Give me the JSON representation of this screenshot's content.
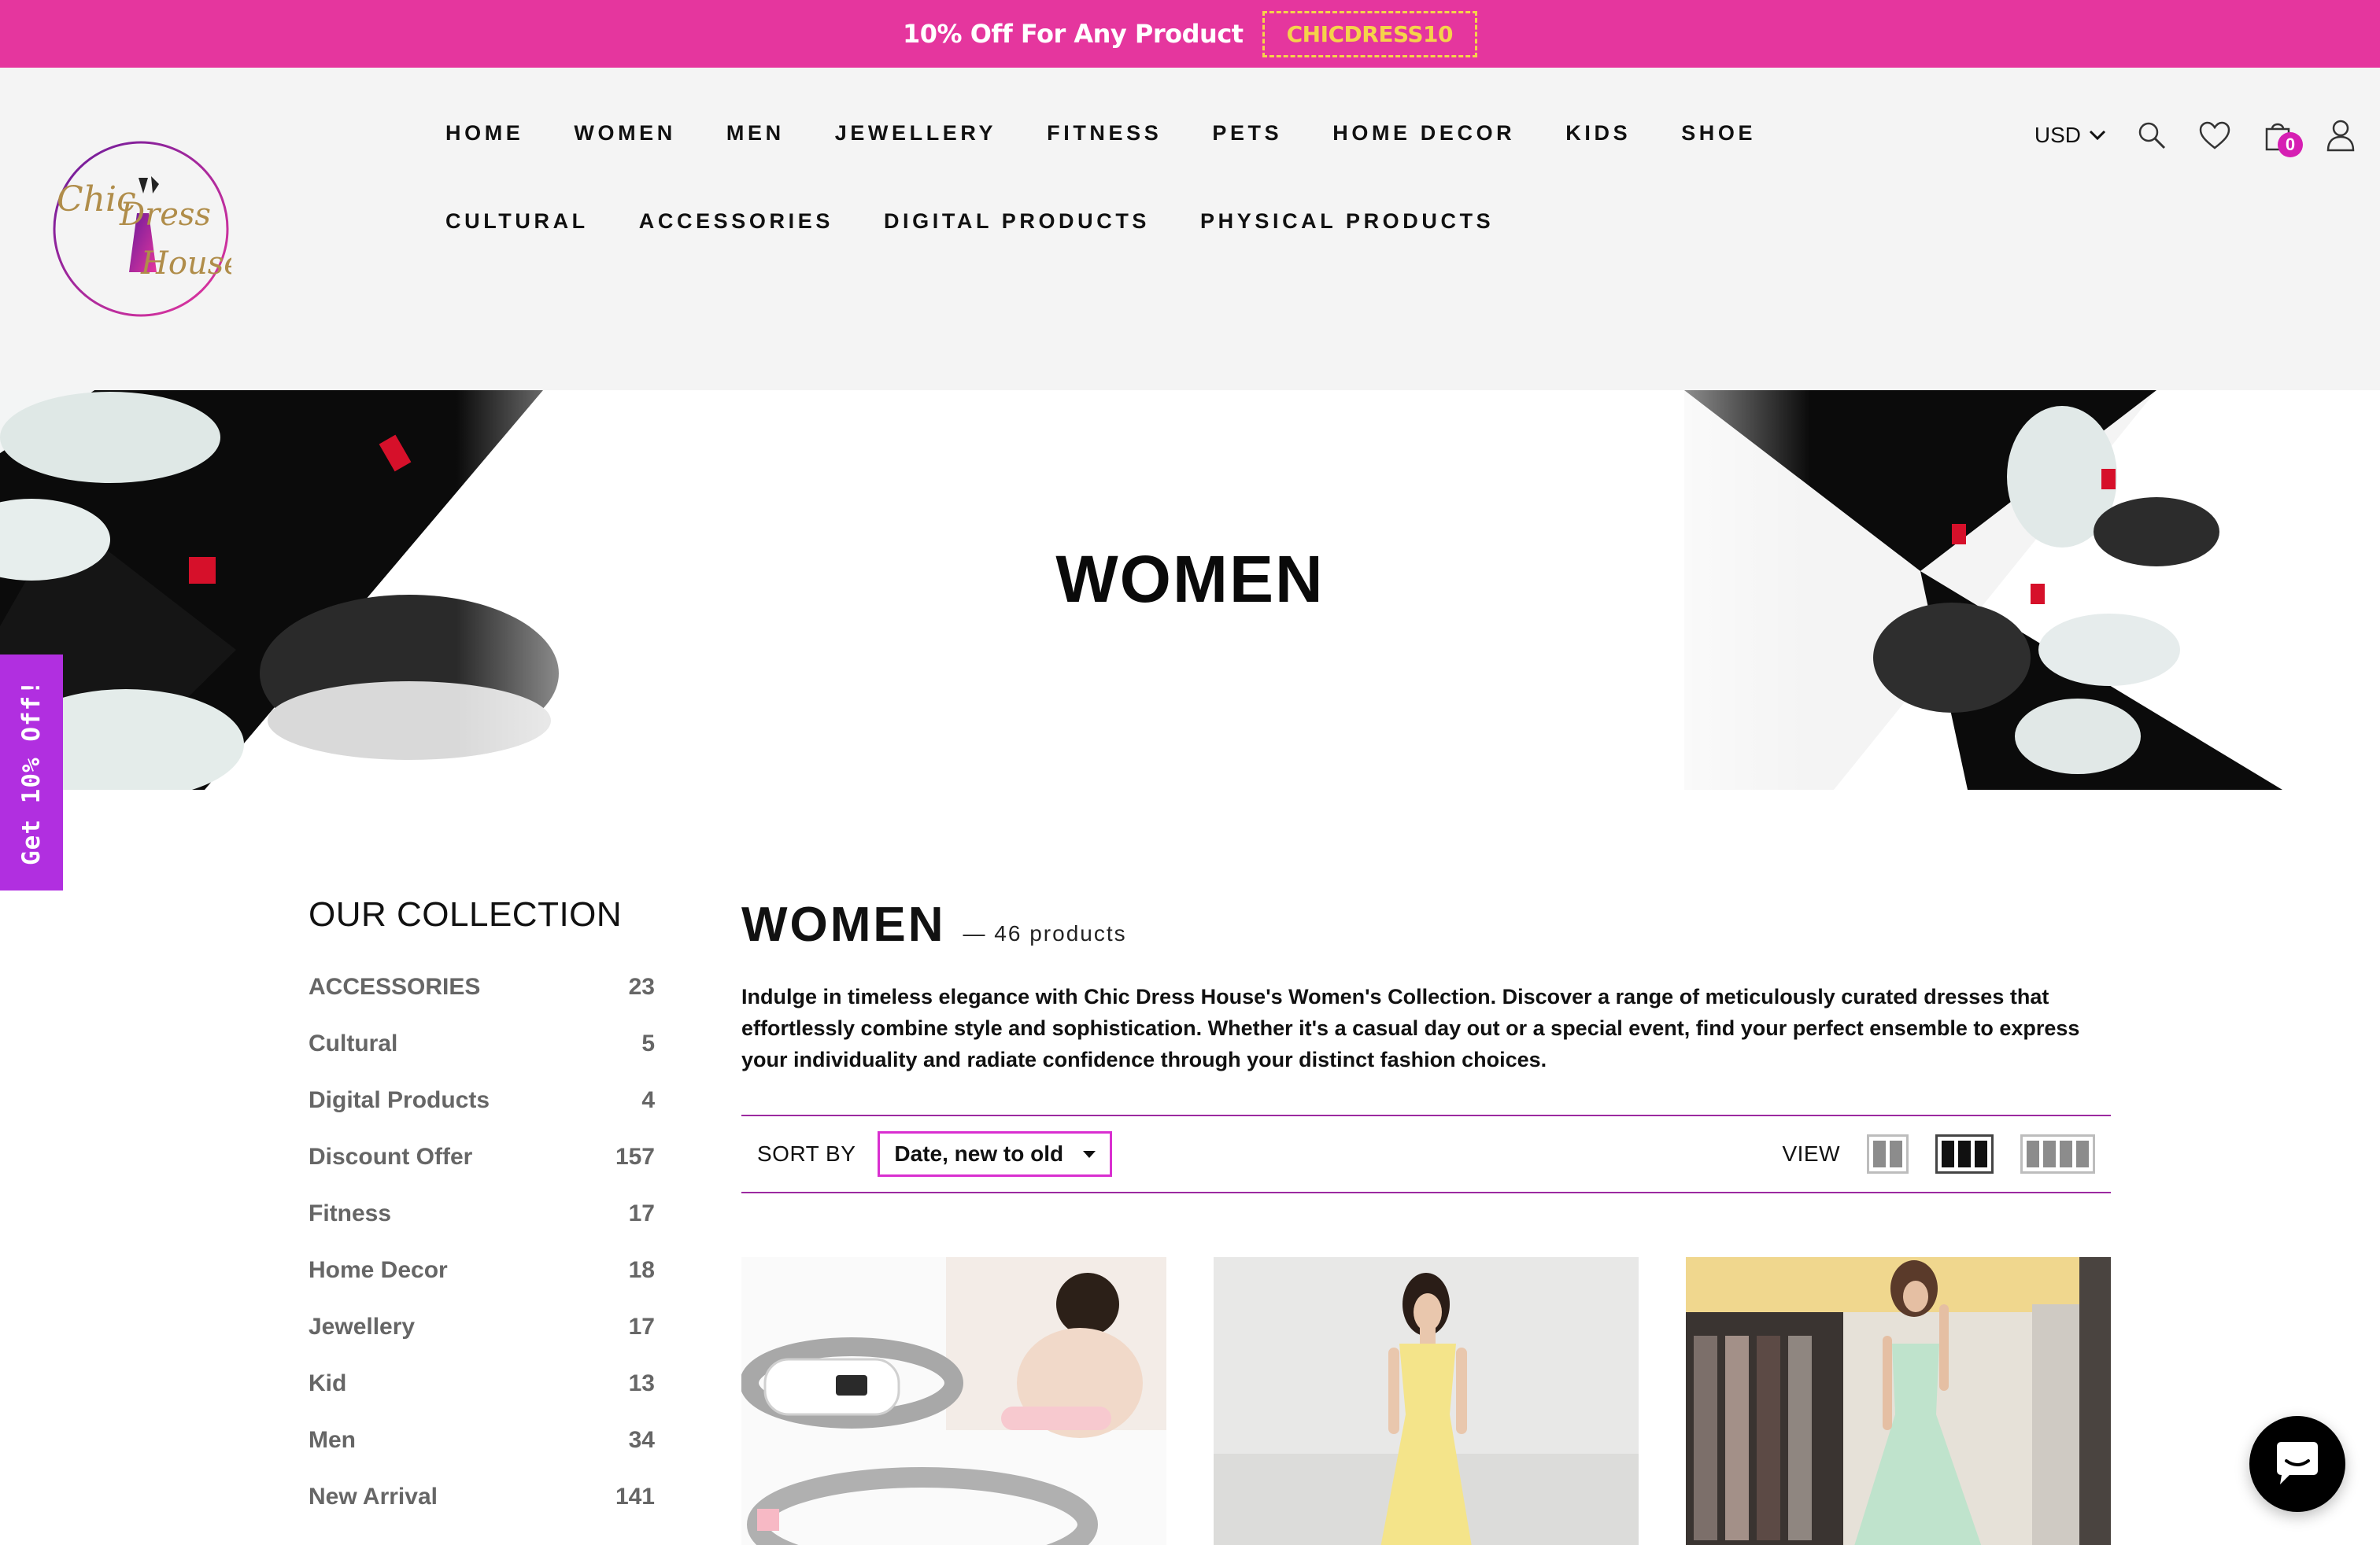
{
  "announcement": {
    "text": "10% Off For Any Product",
    "code": "CHICDRESS10"
  },
  "brand": {
    "logo_lines": [
      "Chic",
      "Dress",
      "House"
    ],
    "accent_pink": "#e5369e",
    "accent_purple": "#b12fe0"
  },
  "nav": {
    "row1": [
      "HOME",
      "WOMEN",
      "MEN",
      "JEWELLERY",
      "FITNESS",
      "PETS",
      "HOME DECOR",
      "KIDS",
      "SHOE"
    ],
    "row2": [
      "CULTURAL",
      "ACCESSORIES",
      "DIGITAL PRODUCTS",
      "PHYSICAL PRODUCTS"
    ]
  },
  "header_tools": {
    "currency": "USD",
    "cart_count": "0",
    "icons": [
      "search-icon",
      "heart-icon",
      "cart-icon",
      "account-icon"
    ]
  },
  "hero": {
    "title": "WOMEN"
  },
  "promo_tab": {
    "label": "Get 10% Off!"
  },
  "sidebar": {
    "title": "OUR COLLECTION",
    "items": [
      {
        "label": "ACCESSORIES",
        "count": "23"
      },
      {
        "label": "Cultural",
        "count": "5"
      },
      {
        "label": "Digital Products",
        "count": "4"
      },
      {
        "label": "Discount Offer",
        "count": "157"
      },
      {
        "label": "Fitness",
        "count": "17"
      },
      {
        "label": "Home Decor",
        "count": "18"
      },
      {
        "label": "Jewellery",
        "count": "17"
      },
      {
        "label": "Kid",
        "count": "13"
      },
      {
        "label": "Men",
        "count": "34"
      },
      {
        "label": "New Arrival",
        "count": "141"
      }
    ]
  },
  "main": {
    "title": "WOMEN",
    "product_count": "— 46 products",
    "description": "Indulge in timeless elegance with Chic Dress House's Women's Collection. Discover a range of meticulously curated dresses that effortlessly combine style and sophistication. Whether it's a casual day out or a special event, find your perfect ensemble to express your individuality and radiate confidence through your distinct fashion choices.",
    "sort_label": "SORT BY",
    "sort_value": "Date, new to old",
    "view_label": "VIEW",
    "view_active": 3
  },
  "products": [
    {
      "image": "heating-belt-product-photo"
    },
    {
      "image": "yellow-maxi-dress-photo"
    },
    {
      "image": "mint-green-dress-photo"
    }
  ]
}
